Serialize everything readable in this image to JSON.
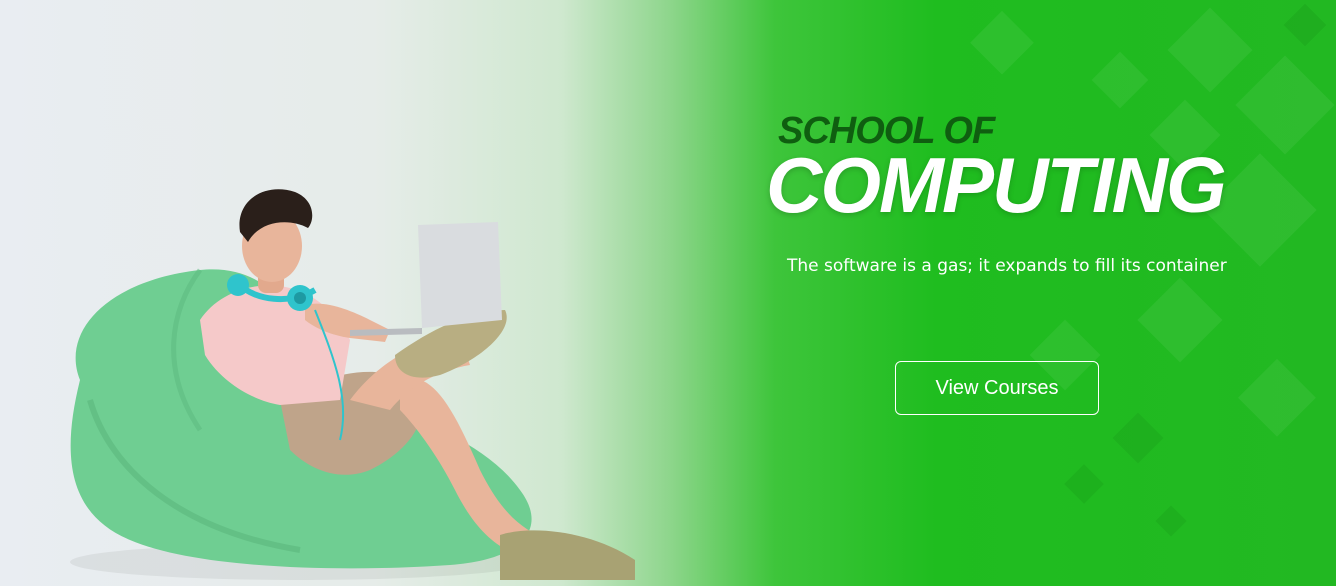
{
  "hero": {
    "kicker": "SCHOOL OF",
    "headline": "COMPUTING",
    "tagline": "The software is a gas; it expands to fill its container",
    "cta_label": "View Courses"
  },
  "colors": {
    "background_left": "#e9edf2",
    "accent_green": "#1fbd1f",
    "kicker_green": "#0f5e10",
    "beanbag": "#6fce92",
    "shirt": "#f5c9c9",
    "shorts": "#bfa48a",
    "headphones": "#2fc4cc"
  },
  "decor": {
    "photo_subject": "man-on-beanbag-with-laptop",
    "pattern": "diamond-pattern"
  }
}
